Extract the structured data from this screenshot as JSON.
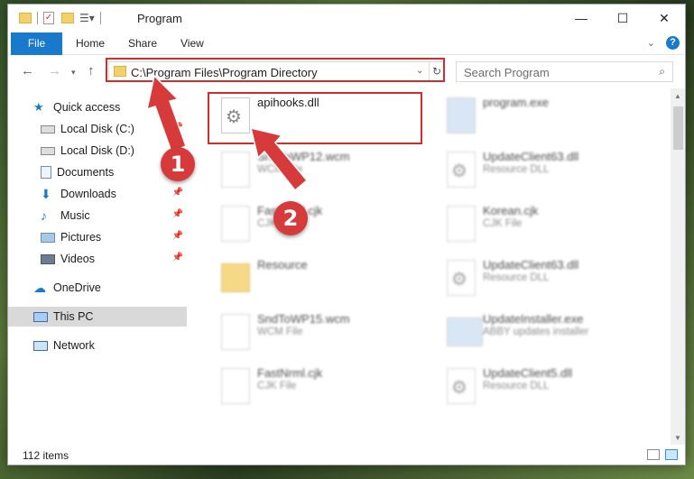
{
  "window": {
    "title": "Program"
  },
  "ribbon": {
    "tabs": [
      "File",
      "Home",
      "Share",
      "View"
    ]
  },
  "address": {
    "path": "C:\\Program Files\\Program Directory"
  },
  "search": {
    "placeholder": "Search Program"
  },
  "sidebar": {
    "items": [
      {
        "label": "Quick access",
        "icon": "star-icon",
        "pinned": false
      },
      {
        "label": "Local Disk (C:)",
        "icon": "drive-icon",
        "pinned": true
      },
      {
        "label": "Local Disk (D:)",
        "icon": "drive-icon",
        "pinned": true
      },
      {
        "label": "Documents",
        "icon": "documents-icon",
        "pinned": true
      },
      {
        "label": "Downloads",
        "icon": "download-icon",
        "pinned": true
      },
      {
        "label": "Music",
        "icon": "music-icon",
        "pinned": true
      },
      {
        "label": "Pictures",
        "icon": "pictures-icon",
        "pinned": true
      },
      {
        "label": "Videos",
        "icon": "videos-icon",
        "pinned": true
      },
      {
        "label": "OneDrive",
        "icon": "cloud-icon",
        "pinned": false
      },
      {
        "label": "This PC",
        "icon": "computer-icon",
        "pinned": false
      },
      {
        "label": "Network",
        "icon": "network-icon",
        "pinned": false
      }
    ]
  },
  "files": [
    {
      "name": "apihooks.dll",
      "type": ""
    },
    {
      "name": "program.exe",
      "type": ""
    },
    {
      "name": "SndToWP12.wcm",
      "type": "WCM File"
    },
    {
      "name": "UpdateClient63.dll",
      "type": "Resource DLL"
    },
    {
      "name": "FastNrml.cjk",
      "type": "CJK File"
    },
    {
      "name": "Korean.cjk",
      "type": "CJK File"
    },
    {
      "name": "Resource",
      "type": ""
    },
    {
      "name": "UpdateClient63.dll",
      "type": "Resource DLL"
    },
    {
      "name": "SndToWP15.wcm",
      "type": "WCM File"
    },
    {
      "name": "UpdateInstaller.exe",
      "type": "ABBY updates installer"
    },
    {
      "name": "FastNrml.cjk",
      "type": "CJK File"
    },
    {
      "name": "UpdateClient5.dll",
      "type": "Resource DLL"
    }
  ],
  "status": {
    "item_count": "112 items"
  },
  "annotations": {
    "step1": "1",
    "step2": "2"
  },
  "colors": {
    "accent": "#1979ca",
    "annotation_red": "#d63a3a",
    "selected_bg": "#d9d9d9"
  }
}
